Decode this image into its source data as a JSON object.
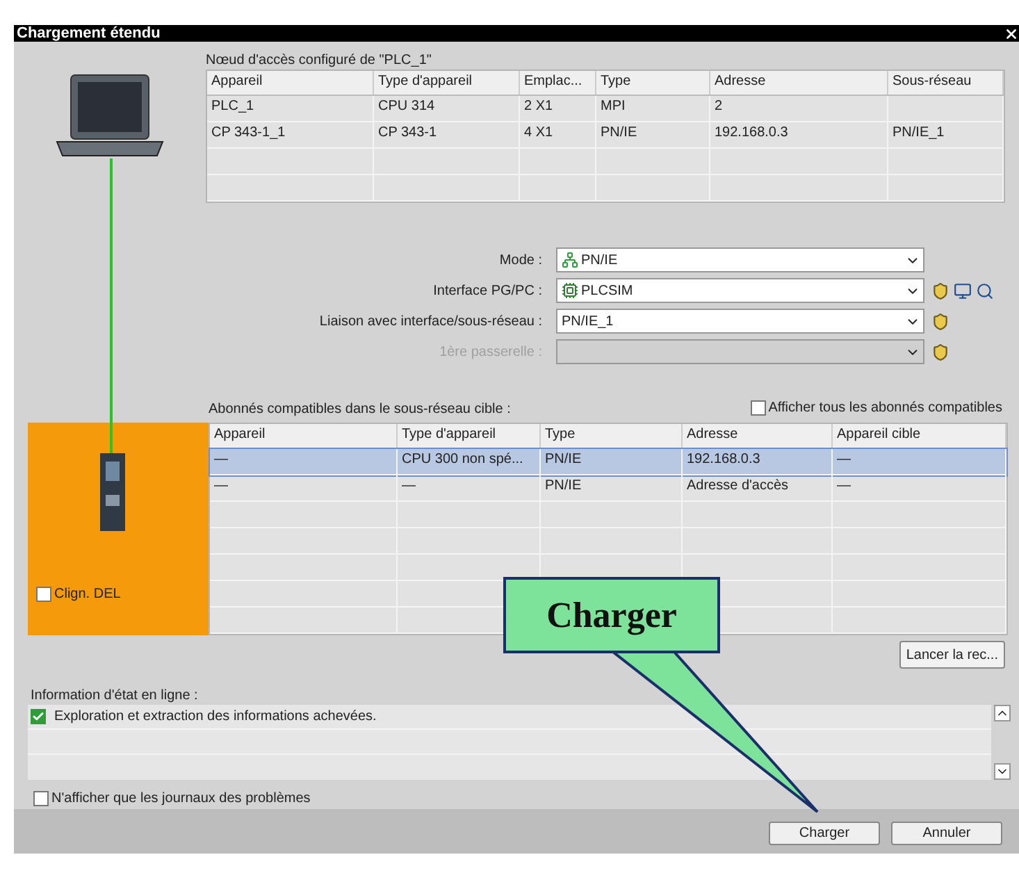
{
  "window": {
    "title": "Chargement étendu"
  },
  "configured": {
    "label": "Nœud d'accès configuré de \"PLC_1\"",
    "columns": [
      "Appareil",
      "Type d'appareil",
      "Emplac...",
      "Type",
      "Adresse",
      "Sous-réseau"
    ],
    "rows": [
      [
        "PLC_1",
        "CPU 314",
        "2 X1",
        "MPI",
        "2",
        ""
      ],
      [
        "CP 343-1_1",
        "CP 343-1",
        "4 X1",
        "PN/IE",
        "192.168.0.3",
        "PN/IE_1"
      ]
    ]
  },
  "fields": [
    {
      "kind": "mode",
      "label": "Mode :",
      "value": "PN/IE",
      "disabled": false
    },
    {
      "kind": "interface",
      "label": "Interface PG/PC :",
      "value": "PLCSIM",
      "disabled": false
    },
    {
      "kind": "link",
      "label": "Liaison avec interface/sous-réseau :",
      "value": "PN/IE_1",
      "disabled": false
    },
    {
      "kind": "gateway",
      "label": "1ère passerelle :",
      "disabled": true
    }
  ],
  "targets": {
    "label": "Abonnés compatibles dans le sous-réseau cible :",
    "show_all": {
      "label": "Afficher tous les abonnés compatibles",
      "checked": false
    },
    "columns": [
      "Appareil",
      "Type d'appareil",
      "Type",
      "Adresse",
      "Appareil cible"
    ],
    "rows": [
      {
        "cells": [
          "—",
          "CPU 300 non spé...",
          "PN/IE",
          "192.168.0.3",
          "—"
        ],
        "selected": true
      },
      {
        "cells": [
          "—",
          "—",
          "PN/IE",
          "Adresse d'accès",
          "—"
        ],
        "selected": false
      }
    ]
  },
  "blink_led": {
    "label": "Clign. DEL",
    "checked": false
  },
  "search_button": "Lancer la rec...",
  "status": {
    "label": "Information d'état en ligne :",
    "entries": [
      {
        "text": "Exploration et extraction des informations achevées.",
        "success": true
      }
    ]
  },
  "problems_only": {
    "label": "N'afficher que les journaux des problèmes",
    "checked": false
  },
  "buttons": [
    "Charger",
    "Annuler"
  ],
  "callout": {
    "text": "Charger"
  }
}
